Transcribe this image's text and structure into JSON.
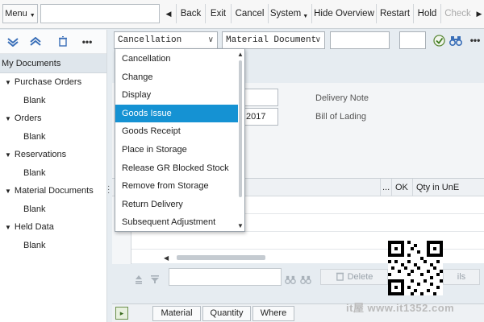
{
  "toolbar": {
    "menu_label": "Menu",
    "command_value": "",
    "nav": [
      "Back",
      "Exit",
      "Cancel",
      "System",
      "Hide Overview",
      "Restart",
      "Hold",
      "Check"
    ]
  },
  "left": {
    "title": "My Documents",
    "tree": [
      {
        "label": "Purchase Orders",
        "child": "Blank"
      },
      {
        "label": "Orders",
        "child": "Blank"
      },
      {
        "label": "Reservations",
        "child": "Blank"
      },
      {
        "label": "Material Documents",
        "child": "Blank"
      },
      {
        "label": "Held Data",
        "child": "Blank"
      }
    ]
  },
  "header": {
    "action_value": "Cancellation",
    "reference_value": "Material Document"
  },
  "panel": {
    "date_value": ".2017",
    "delivery_note_label": "Delivery Note",
    "bill_of_lading_label": "Bill of Lading"
  },
  "grid": {
    "col_ellipsis": "...",
    "col_ok": "OK",
    "col_qty": "Qty in UnE"
  },
  "buttons": {
    "delete_label": "Delete",
    "hidden_label": "ils"
  },
  "tabs": [
    "Material",
    "Quantity",
    "Where"
  ],
  "dropdown": {
    "items": [
      "Cancellation",
      "Change",
      "Display",
      "Goods Issue",
      "Goods Receipt",
      "Place in Storage",
      "Release GR Blocked Stock",
      "Remove from Storage",
      "Return Delivery",
      "Subsequent Adjustment"
    ],
    "selected": "Goods Issue"
  },
  "watermark": {
    "text": "it屋 www.it1352.com"
  },
  "colors": {
    "selection": "#1592d3",
    "accent": "#3a6fb8"
  }
}
